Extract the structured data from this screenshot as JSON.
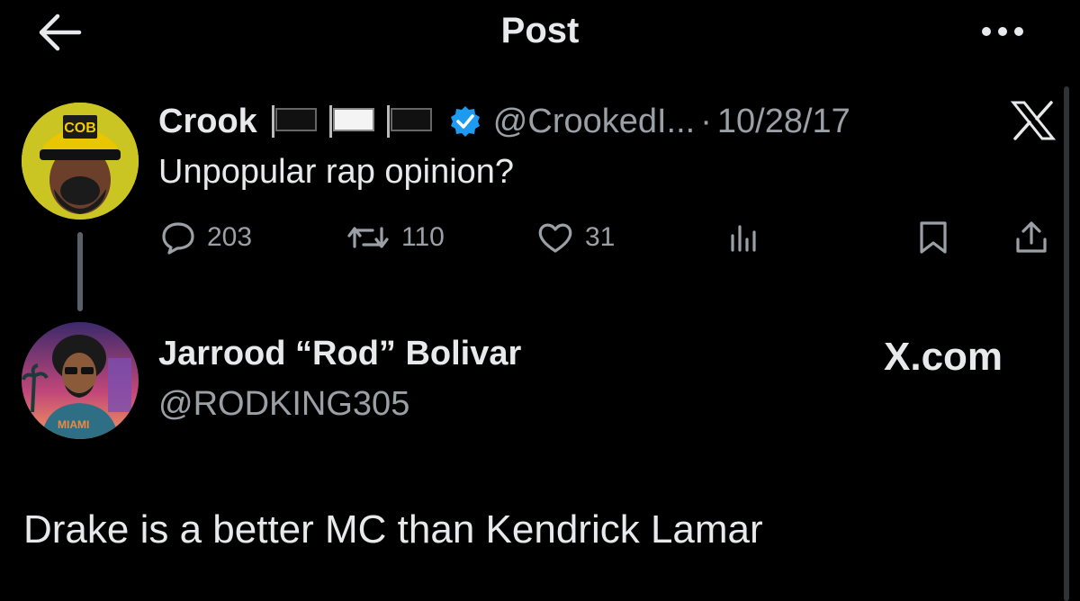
{
  "header": {
    "title": "Post"
  },
  "parent_tweet": {
    "author_name": "Crook",
    "handle": "@CrookedI...",
    "separator": "·",
    "date": "10/28/17",
    "text": "Unpopular rap opinion?",
    "flags": [
      "black-flag",
      "white-flag",
      "black-flag"
    ],
    "verified_color": "#1d9bf0",
    "avatar_cap_text": "COB",
    "actions": {
      "replies": "203",
      "reposts": "110",
      "likes": "31"
    }
  },
  "reply_user": {
    "name": "Jarrood “Rod” Bolivar",
    "handle": "@RODKING305",
    "jersey_text": "MIAMI"
  },
  "brand": {
    "watermark": "X.com"
  },
  "main_text": "Drake is a better MC than Kendrick Lamar",
  "colors": {
    "background": "#000000",
    "text": "#e7e9ea",
    "secondary": "#9aa0a6",
    "accent": "#1d9bf0"
  }
}
